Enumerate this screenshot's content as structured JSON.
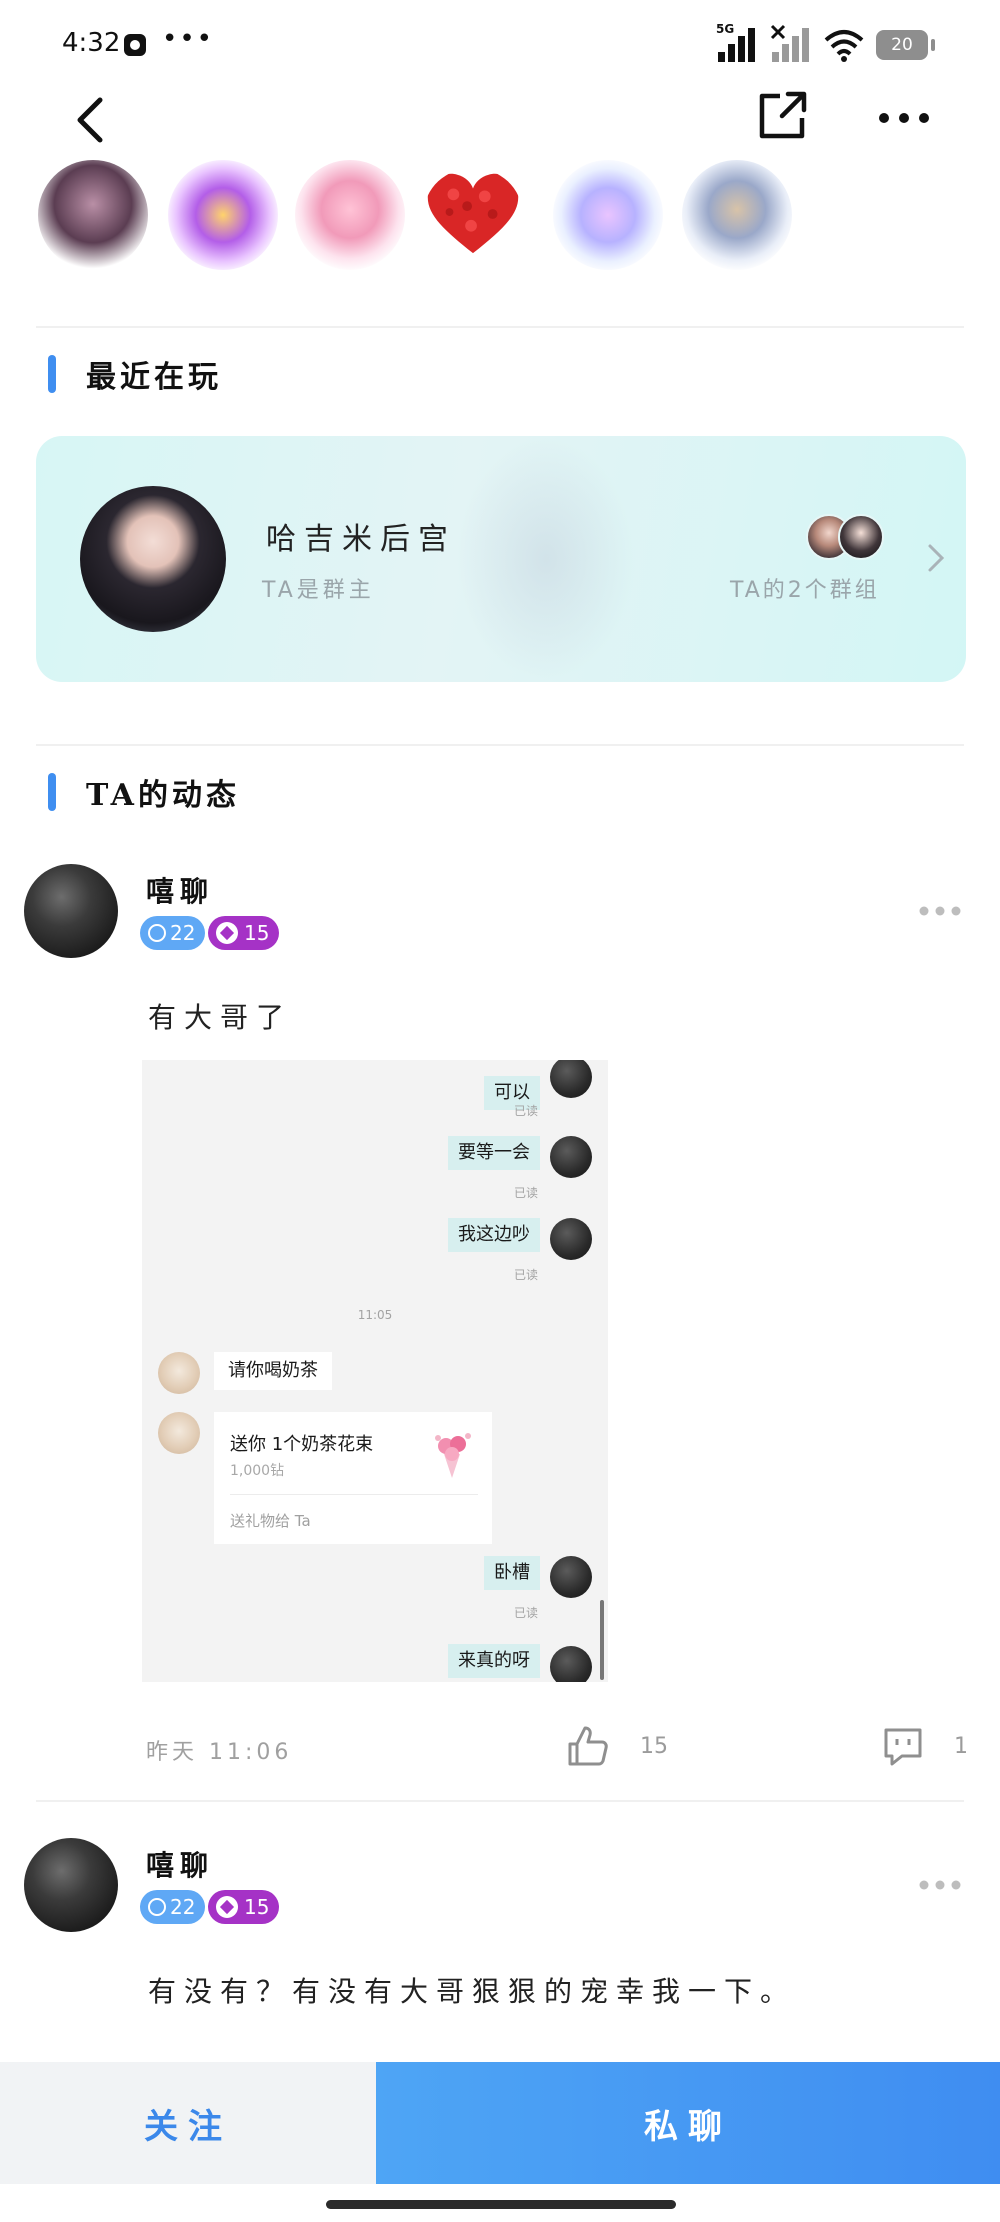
{
  "status_bar": {
    "time": "4:32",
    "network": "5G",
    "battery": "20"
  },
  "decorations": [
    "couple-frame-icon",
    "treasure-chest-icon",
    "anime-girl-icon",
    "heart-icon",
    "crystal-ball-icon",
    "anime-couple-icon"
  ],
  "recent_play": {
    "title": "最近在玩",
    "group_name": "哈吉米后宫",
    "role": "TA是群主",
    "groups_text": "TA的2个群组"
  },
  "feed": {
    "title": "TA的动态",
    "posts": [
      {
        "name": "嘻聊",
        "age": "22",
        "level": "15",
        "text": "有大哥了",
        "date": "昨天 11:06",
        "likes": "15",
        "comments": "1",
        "screenshot": {
          "messages_right_top": [
            {
              "text": "可以",
              "status": "已读"
            },
            {
              "text": "要等一会",
              "status": "已读"
            },
            {
              "text": "我这边吵",
              "status": "已读"
            }
          ],
          "time": "11:05",
          "message_left": "请你喝奶茶",
          "gift": {
            "title": "送你 1个奶茶花束",
            "price": "1,000钻",
            "action": "送礼物给 Ta"
          },
          "messages_right_bottom": [
            {
              "text": "卧槽",
              "status": "已读"
            },
            {
              "text": "来真的呀",
              "status": ""
            }
          ]
        }
      },
      {
        "name": "嘻聊",
        "age": "22",
        "level": "15",
        "text": "有没有？有没有大哥狠狠的宠幸我一下。"
      }
    ]
  },
  "bottom_bar": {
    "follow": "关注",
    "chat": "私聊"
  },
  "colors": {
    "accent": "#3f8ef0",
    "badge_age": "#5fa8f5",
    "badge_level": "#a532c6",
    "card_bg": "#d9f5f5"
  }
}
